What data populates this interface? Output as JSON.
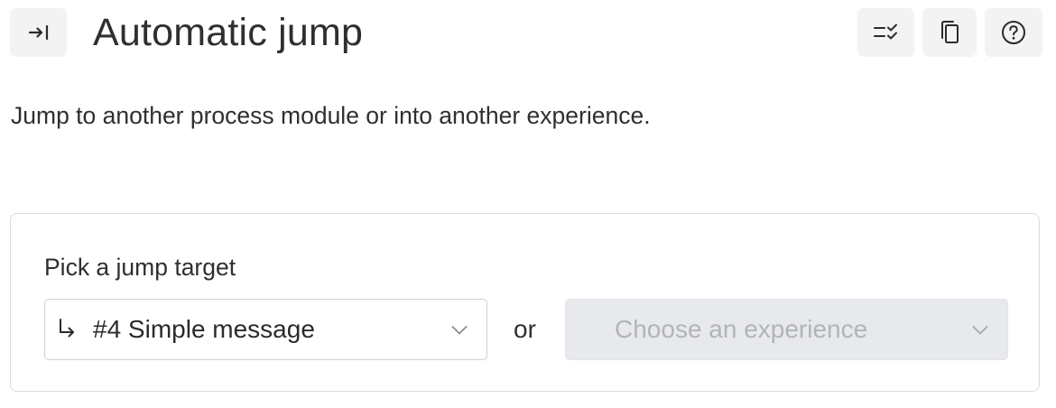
{
  "header": {
    "title": "Automatic jump",
    "collapse_icon": "collapse-right-icon",
    "actions": [
      {
        "name": "checklist",
        "icon": "checklist-icon"
      },
      {
        "name": "duplicate",
        "icon": "copy-icon"
      },
      {
        "name": "help",
        "icon": "help-circle-icon"
      }
    ]
  },
  "description": "Jump to another process module or into another experience.",
  "jump_card": {
    "label": "Pick a jump target",
    "target_select": {
      "icon": "return-arrow-icon",
      "value": "#4 Simple message"
    },
    "separator": "or",
    "experience_select": {
      "placeholder": "Choose an experience",
      "disabled": true
    }
  },
  "colors": {
    "icon_button_bg": "#f3f3f4",
    "disabled_select_bg": "#e8e9ec",
    "placeholder_text": "#b2b4ba",
    "border": "#dcdcdf"
  }
}
